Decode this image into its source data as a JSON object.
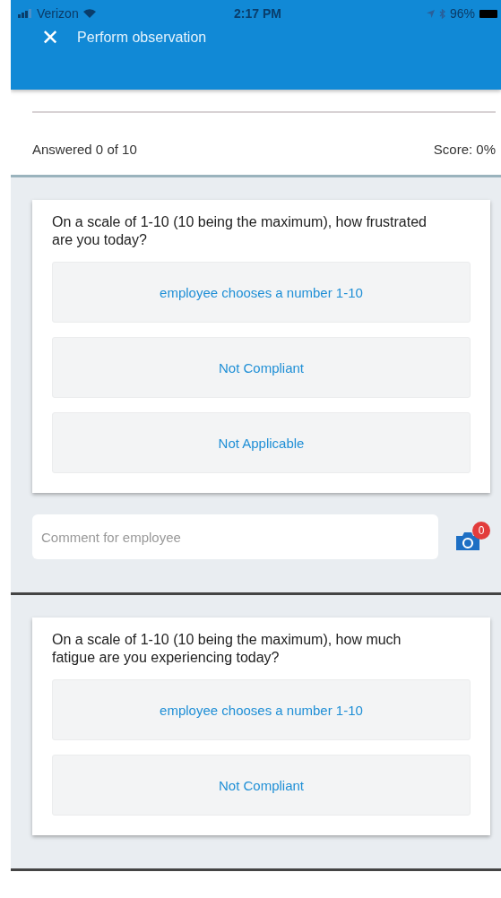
{
  "status_bar": {
    "carrier": "Verizon",
    "time": "2:17 PM",
    "battery": "96%"
  },
  "header": {
    "close": "✕",
    "title": "Perform observation"
  },
  "progress": {
    "answered": "Answered 0 of 10",
    "score": "Score: 0%"
  },
  "questions": [
    {
      "text": "On a scale of 1-10 (10 being the maximum), how frustrated are you today?",
      "options": [
        "employee chooses a number 1-10",
        "Not Compliant",
        "Not Applicable"
      ],
      "comment_placeholder": "Comment for employee",
      "photo_count": "0"
    },
    {
      "text": "On a scale of 1-10 (10 being the maximum), how much fatigue are you experiencing today?",
      "options": [
        "employee chooses a number 1-10",
        "Not Compliant"
      ]
    }
  ]
}
